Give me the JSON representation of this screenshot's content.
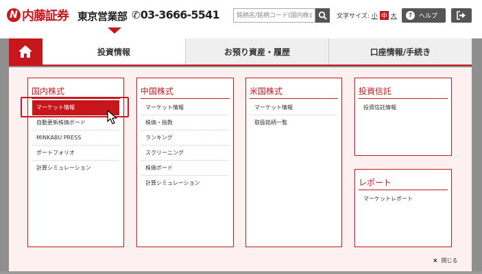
{
  "header": {
    "logo_mark": "N",
    "logo_text": "内藤証券",
    "branch": "東京営業部",
    "phone_icon": "phone-icon",
    "phone": "03-3666-5541",
    "search_placeholder": "銘柄名/銘柄コード(国内株式)",
    "fontsize_label": "文字サイズ:",
    "fontsize_options": [
      "小",
      "中",
      "大"
    ],
    "fontsize_selected": "中",
    "help_label": "ヘルプ",
    "help_icon": "?",
    "logout_icon": "logout-icon"
  },
  "nav": {
    "home_icon": "home-icon",
    "tabs": [
      {
        "label": "投資情報",
        "active": true
      },
      {
        "label": "お預り資産・履歴",
        "active": false
      },
      {
        "label": "口座情報/手続き",
        "active": false
      }
    ]
  },
  "menu": {
    "domestic": {
      "title": "国内株式",
      "items": [
        "マーケット情報",
        "自動更新株価ボード",
        "MINKABU PRESS",
        "ポートフォリオ",
        "計算シミュレーション"
      ],
      "selected": "マーケット情報"
    },
    "china": {
      "title": "中国株式",
      "items": [
        "マーケット情報",
        "株価・指数",
        "ランキング",
        "スクリーニング",
        "株価ボード",
        "計算シミュレーション"
      ]
    },
    "us": {
      "title": "米国株式",
      "items": [
        "マーケット情報",
        "取扱銘柄一覧"
      ]
    },
    "fund": {
      "title": "投資信託",
      "items": [
        "投資信託情報"
      ]
    },
    "report": {
      "title": "レポート",
      "items": [
        "マーケットレポート"
      ]
    },
    "close_icon": "×",
    "close_label": "閉じる"
  },
  "colors": {
    "brand": "#c8161d",
    "panel_bg": "#fdf0f0",
    "button_dark": "#555555"
  }
}
